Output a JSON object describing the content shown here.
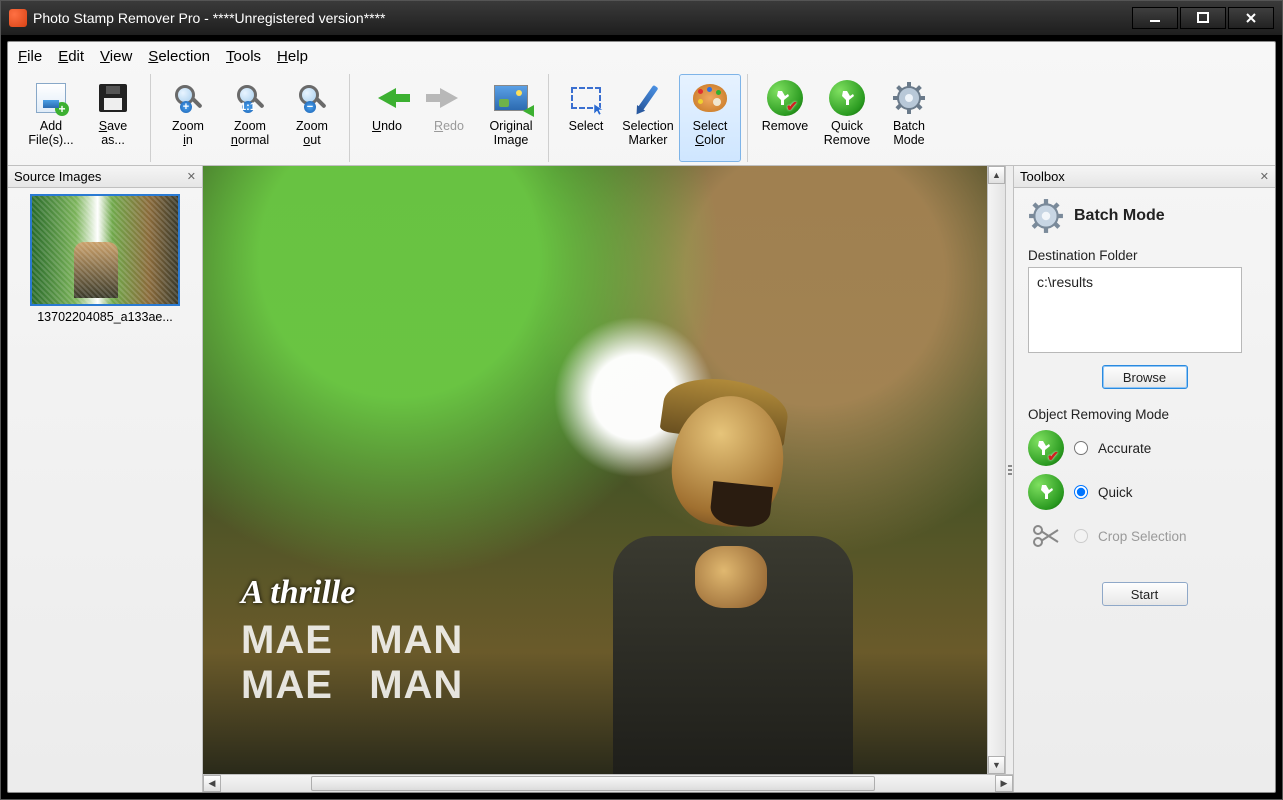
{
  "titlebar": {
    "title": "Photo Stamp Remover Pro - ****Unregistered version****"
  },
  "menu": {
    "file": "File",
    "edit": "Edit",
    "view": "View",
    "selection": "Selection",
    "tools": "Tools",
    "help": "Help"
  },
  "toolbar": {
    "add": "Add\nFile(s)...",
    "save": "Save\nas...",
    "zin": "Zoom\nin",
    "znorm": "Zoom\nnormal",
    "zout": "Zoom\nout",
    "undo": "Undo",
    "redo": "Redo",
    "orig": "Original\nImage",
    "select": "Select",
    "marker": "Selection\nMarker",
    "color": "Select\nColor",
    "remove": "Remove",
    "qremove": "Quick\nRemove",
    "batch": "Batch\nMode"
  },
  "left": {
    "title": "Source Images",
    "thumb_name": "13702204085_a133ae..."
  },
  "right": {
    "title": "Toolbox",
    "mode_title": "Batch Mode",
    "dest_label": "Destination Folder",
    "dest_value": "c:\\results",
    "browse": "Browse",
    "orm_label": "Object Removing Mode",
    "opt_acc": "Accurate",
    "opt_quick": "Quick",
    "opt_crop": "Crop Selection",
    "start": "Start"
  },
  "canvas": {
    "text1": "A thrille",
    "text2": "MAE   MAN\nMAE   MAN"
  }
}
